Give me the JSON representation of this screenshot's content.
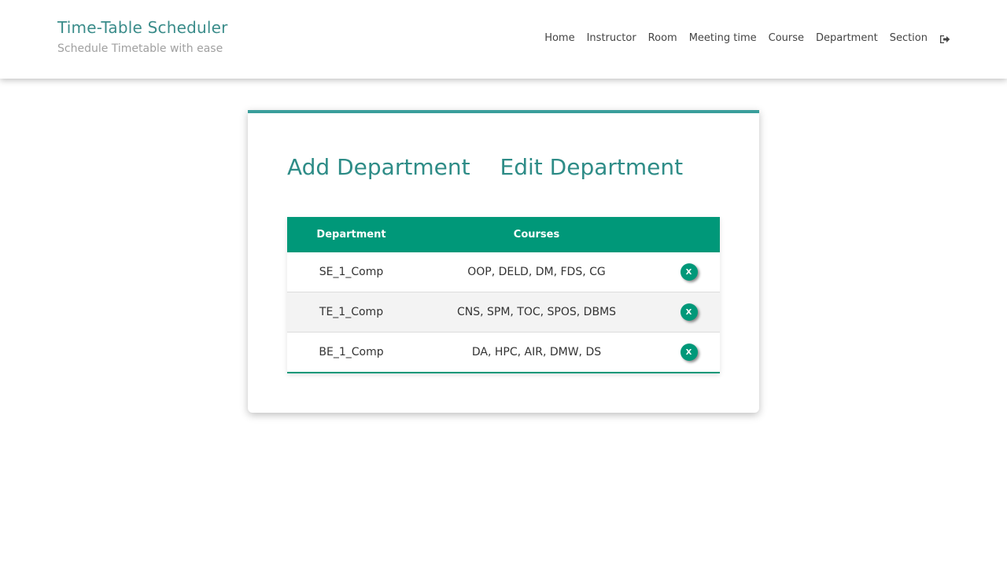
{
  "header": {
    "title": "Time-Table Scheduler",
    "subtitle": "Schedule Timetable with ease",
    "nav": [
      "Home",
      "Instructor",
      "Room",
      "Meeting time",
      "Course",
      "Department",
      "Section"
    ],
    "logout_icon": "logout-icon"
  },
  "card": {
    "add_label": "Add Department",
    "edit_label": "Edit Department",
    "accent_color": "#3a9e9b"
  },
  "table": {
    "headers": [
      "Department",
      "Courses",
      ""
    ],
    "header_color": "#009879",
    "rows": [
      {
        "department": "SE_1_Comp",
        "courses": "OOP, DELD, DM, FDS, CG",
        "delete_label": "X"
      },
      {
        "department": "TE_1_Comp",
        "courses": "CNS, SPM, TOC, SPOS, DBMS",
        "delete_label": "X"
      },
      {
        "department": "BE_1_Comp",
        "courses": "DA, HPC, AIR, DMW, DS",
        "delete_label": "X"
      }
    ]
  }
}
